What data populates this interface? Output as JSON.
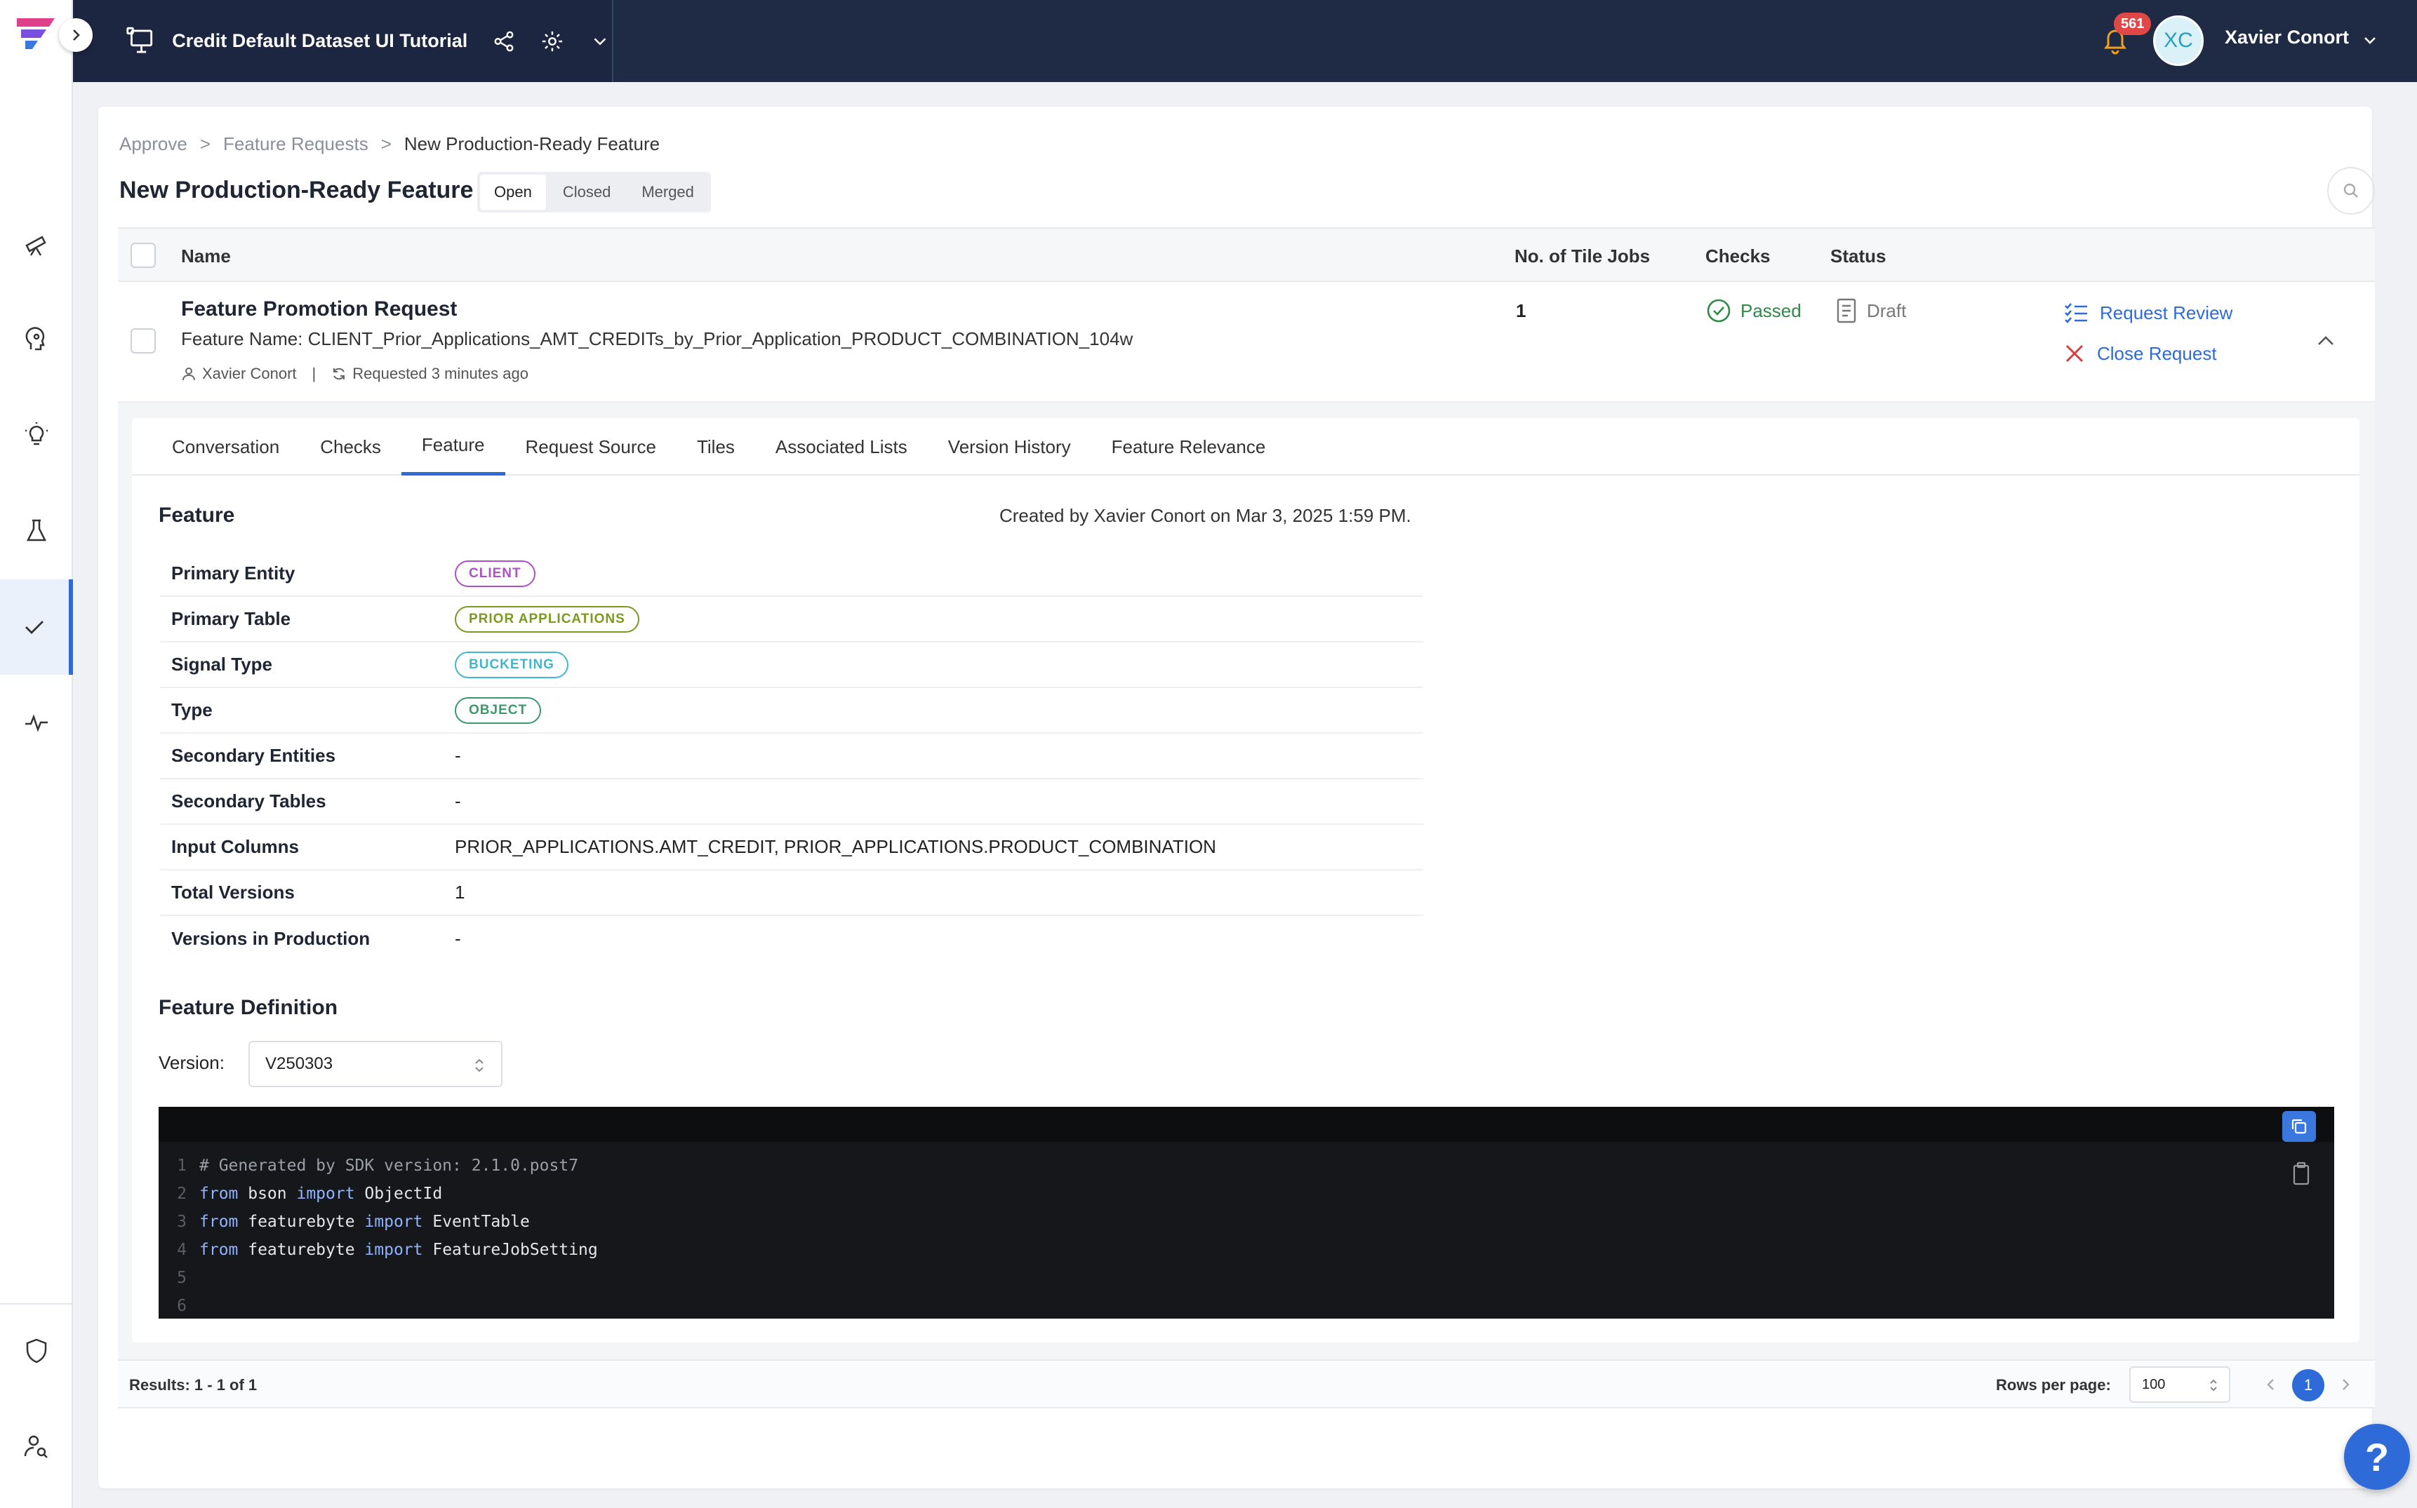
{
  "header": {
    "project_title": "Credit Default Dataset UI Tutorial",
    "notification_count": "561",
    "user_initials": "XC",
    "user_name": "Xavier Conort"
  },
  "breadcrumb": [
    "Approve",
    ">",
    "Feature Requests",
    ">",
    "New Production-Ready Feature"
  ],
  "page": {
    "title": "New Production-Ready Feature",
    "filters": [
      "Open",
      "Closed",
      "Merged"
    ],
    "active_filter": "Open"
  },
  "table": {
    "columns": [
      "Name",
      "No. of Tile Jobs",
      "Checks",
      "Status"
    ],
    "row": {
      "title": "Feature Promotion Request",
      "feature_name": "Feature Name: CLIENT_Prior_Applications_AMT_CREDITs_by_Prior_Application_PRODUCT_COMBINATION_104w",
      "requester": "Xavier Conort",
      "separator": "|",
      "requested": "Requested 3 minutes ago",
      "tile_jobs": "1",
      "checks": "Passed",
      "status": "Draft",
      "actions": [
        "Request Review",
        "Close Request"
      ]
    }
  },
  "tabs": [
    "Conversation",
    "Checks",
    "Feature",
    "Request Source",
    "Tiles",
    "Associated Lists",
    "Version History",
    "Feature Relevance"
  ],
  "active_tab": "Feature",
  "feature": {
    "section_title": "Feature",
    "created_by": "Created by Xavier Conort on Mar 3, 2025 1:59 PM.",
    "properties": [
      {
        "key": "Primary Entity",
        "value": "CLIENT",
        "pill": true,
        "color": "#b04fc6"
      },
      {
        "key": "Primary Table",
        "value": "PRIOR APPLICATIONS",
        "pill": true,
        "color": "#7a9a1f"
      },
      {
        "key": "Signal Type",
        "value": "BUCKETING",
        "pill": true,
        "color": "#3fb6cf"
      },
      {
        "key": "Type",
        "value": "OBJECT",
        "pill": true,
        "color": "#3a9a6a"
      },
      {
        "key": "Secondary Entities",
        "value": "-"
      },
      {
        "key": "Secondary Tables",
        "value": "-"
      },
      {
        "key": "Input Columns",
        "value": "PRIOR_APPLICATIONS.AMT_CREDIT, PRIOR_APPLICATIONS.PRODUCT_COMBINATION"
      },
      {
        "key": "Total Versions",
        "value": "1"
      },
      {
        "key": "Versions in Production",
        "value": "-"
      }
    ]
  },
  "definition": {
    "section_title": "Feature Definition",
    "version_label": "Version:",
    "version_value": "V250303",
    "code": [
      {
        "n": "1",
        "parts": [
          {
            "t": "# Generated by SDK version: 2.1.0.post7",
            "c": "cm"
          }
        ]
      },
      {
        "n": "2",
        "parts": [
          {
            "t": "from",
            "c": "kw"
          },
          {
            "t": " bson "
          },
          {
            "t": "import",
            "c": "kw"
          },
          {
            "t": " ObjectId"
          }
        ]
      },
      {
        "n": "3",
        "parts": [
          {
            "t": "from",
            "c": "kw"
          },
          {
            "t": " featurebyte "
          },
          {
            "t": "import",
            "c": "kw"
          },
          {
            "t": " EventTable"
          }
        ]
      },
      {
        "n": "4",
        "parts": [
          {
            "t": "from",
            "c": "kw"
          },
          {
            "t": " featurebyte "
          },
          {
            "t": "import",
            "c": "kw"
          },
          {
            "t": " FeatureJobSetting"
          }
        ]
      },
      {
        "n": "5",
        "parts": []
      },
      {
        "n": "6",
        "parts": []
      }
    ]
  },
  "footer": {
    "results": "Results: 1 - 1 of 1",
    "rows_per_page_label": "Rows per page:",
    "rows_per_page_value": "100",
    "current_page": "1"
  },
  "help_label": "?",
  "colors": {
    "accent": "#2f6bd8",
    "topbar": "#1f2a44",
    "passed": "#2e8a46"
  }
}
